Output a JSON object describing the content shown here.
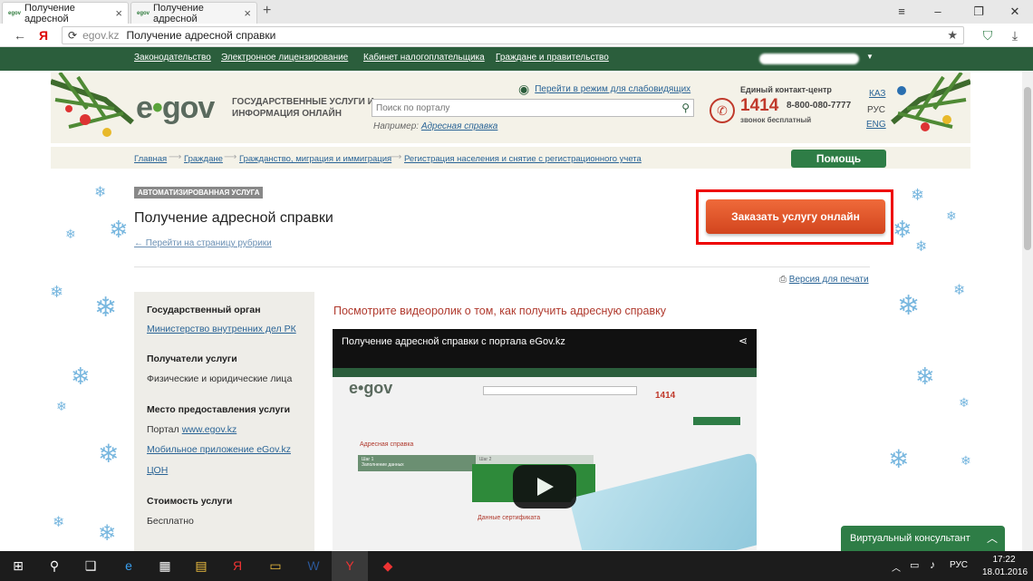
{
  "browser": {
    "tabs": [
      {
        "label": "Получение адресной",
        "favicon": "egov"
      },
      {
        "label": "Получение адресной",
        "favicon": "egov"
      }
    ],
    "new_tab": "+",
    "url_host": "egov.kz",
    "url_title": "Получение адресной справки",
    "yandex_glyph": "Я"
  },
  "topnav": {
    "links": [
      "Законодательство",
      "Электронное лицензирование",
      "Кабинет налогоплательщика",
      "Граждане и правительство"
    ]
  },
  "header": {
    "logo_text": "e gov",
    "slogan": "ГОСУДАРСТВЕННЫЕ УСЛУГИ И ИНФОРМАЦИЯ ОНЛАЙН",
    "low_vision": "Перейти в режим для слабовидящих",
    "search_placeholder": "Поиск по порталу",
    "example_label": "Например:",
    "example_link": "Адресная справка",
    "contact_title": "Единый контакт-центр",
    "phone_main": "1414",
    "phone_alt": "8-800-080-7777",
    "phone_free": "звонок бесплатный",
    "langs": [
      "КАЗ",
      "РУС",
      "ENG"
    ]
  },
  "breadcrumb": [
    "Главная",
    "Граждане",
    "Гражданство, миграция и иммиграция",
    "Регистрация населения и снятие с регистрационного учета"
  ],
  "help_button": "Помощь",
  "main": {
    "badge": "АВТОМАТИЗИРОВАННАЯ УСЛУГА",
    "title": "Получение адресной справки",
    "back_link": "← Перейти на страницу рубрики",
    "order_button": "Заказать услугу онлайн",
    "print_link": "Версия для печати"
  },
  "infobox": {
    "org_heading": "Государственный орган",
    "org_link": "Министерство внутренних дел РК",
    "recipients_heading": "Получатели услуги",
    "recipients_text": "Физические и юридические лица",
    "place_heading": "Место предоставления услуги",
    "place_prefix": "Портал",
    "place_link1": "www.egov.kz",
    "place_link2": "Мобильное приложение eGov.kz",
    "place_link3": "ЦОН",
    "cost_heading": "Стоимость услуги",
    "cost_text": "Бесплатно"
  },
  "video": {
    "heading": "Посмотрите видеоролик о том, как получить адресную справку",
    "title": "Получение адресной справки с портала eGov.kz",
    "inner_section": "Адресная справка",
    "inner_step1": "Шаг 1",
    "inner_step1_sub": "Заполнение данных",
    "inner_step2": "Шаг 2",
    "inner_cert": "Данные сертификата"
  },
  "consultant": "Виртуальный консультант",
  "taskbar": {
    "lang": "РУС",
    "time": "17:22",
    "date": "18.01.2016"
  }
}
